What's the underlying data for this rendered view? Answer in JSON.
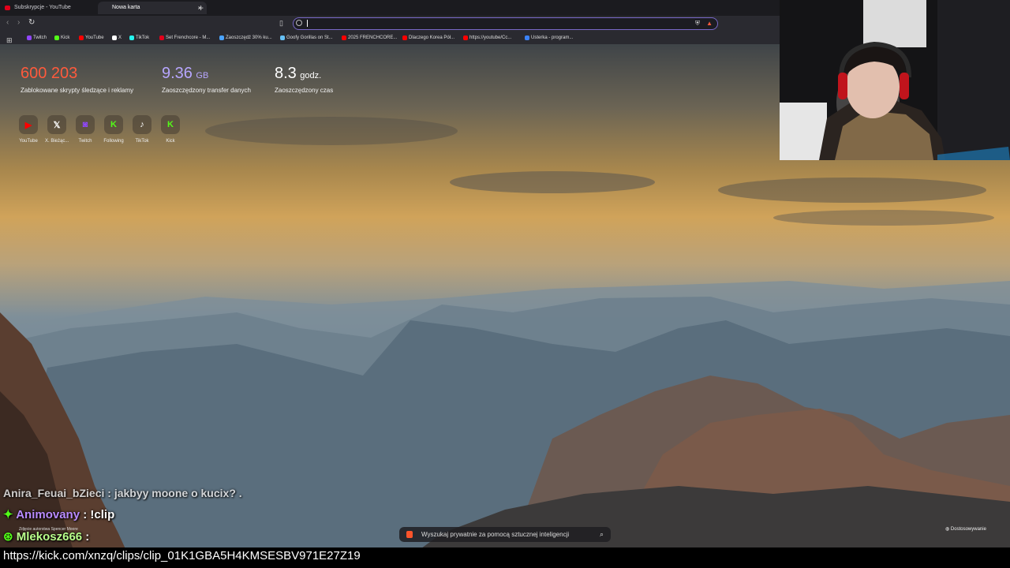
{
  "tabs": [
    {
      "title": "Subskrypcje - YouTube",
      "active": false
    },
    {
      "title": "Nowa karta",
      "active": true
    }
  ],
  "tab_close": "×",
  "new_tab": "+",
  "bookmarks": [
    {
      "label": "Twitch",
      "color": "#9146ff"
    },
    {
      "label": "Kick",
      "color": "#53fc18"
    },
    {
      "label": "YouTube",
      "color": "#ff0000"
    },
    {
      "label": "X",
      "color": "#ffffff"
    },
    {
      "label": "TikTok",
      "color": "#25f4ee"
    },
    {
      "label": "Set Frenchcore - M...",
      "color": "#e1001a"
    },
    {
      "label": "Zaoszczędź 30% ku...",
      "color": "#4aa3ff"
    },
    {
      "label": "Goofy Gorillas on St...",
      "color": "#66c0f4"
    },
    {
      "label": "2025 FRENCHCORE...",
      "color": "#ff0000"
    },
    {
      "label": "Dlaczego Korea Pół...",
      "color": "#ff0000"
    },
    {
      "label": "https://youtube/Cc...",
      "color": "#ff0000"
    },
    {
      "label": "Usterka - program...",
      "color": "#3b82f6"
    }
  ],
  "stats": [
    {
      "value": "600 203",
      "unit": "",
      "label": "Zablokowane skrypty śledzące i reklamy",
      "color": "#ff5a3c"
    },
    {
      "value": "9.36",
      "unit": "GB",
      "label": "Zaoszczędzony transfer danych",
      "color": "#b7a6ff"
    },
    {
      "value": "8.3",
      "unit": "godz.",
      "label": "Zaoszczędzony czas",
      "color": "#ffffff"
    }
  ],
  "shortcuts": [
    {
      "name": "YouTube",
      "icon": "youtube-icon",
      "glyph": "▶",
      "color": "#ff0000"
    },
    {
      "name": "X. Bieżąc...",
      "icon": "x-icon",
      "glyph": "𝕏",
      "color": "#ffffff"
    },
    {
      "name": "Twitch",
      "icon": "twitch-icon",
      "glyph": "◙",
      "color": "#9146ff"
    },
    {
      "name": "Following",
      "icon": "kick-icon",
      "glyph": "K",
      "color": "#53fc18"
    },
    {
      "name": "TikTok",
      "icon": "tiktok-icon",
      "glyph": "♪",
      "color": "#ffffff"
    },
    {
      "name": "Kick",
      "icon": "kick-icon",
      "glyph": "K",
      "color": "#53fc18"
    }
  ],
  "chat": [
    {
      "user": "Animovany",
      "message": " : !clip",
      "user_color": "#b98bff"
    },
    {
      "user": "Mlekosz666",
      "message": " :",
      "user_color": "#b9ff8b"
    }
  ],
  "chat_partial": "Anira_Feuai_bZieci : jakbyy moone o kucix? .",
  "photo_credit": "Zdjęcie autorstwa Spencer Moore",
  "ai_search_placeholder": "Wyszukaj prywatnie za pomocą sztucznej inteligencji",
  "customize_label": "Dostosowywanie",
  "bottom_url": "https://kick.com/xnzq/clips/clip_01K1GBA5H4KMSESBV971E27Z19"
}
